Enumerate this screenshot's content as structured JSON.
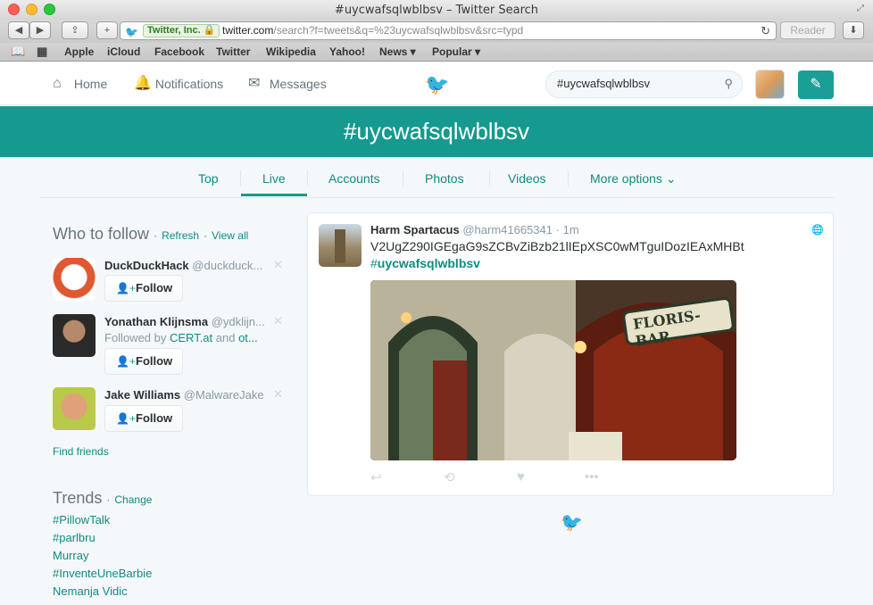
{
  "window": {
    "title": "#uycwafsqlwblbsv – Twitter Search"
  },
  "browser": {
    "ev_badge": "Twitter, Inc.",
    "url_host": "twitter.com",
    "url_path": "/search?f=tweets&q=%23uycwafsqlwblbsv&src=typd",
    "reader_label": "Reader",
    "bookmarks": [
      "Apple",
      "iCloud",
      "Facebook",
      "Twitter",
      "Wikipedia",
      "Yahoo!",
      "News ▾",
      "Popular ▾"
    ]
  },
  "nav": {
    "home": "Home",
    "notifications": "Notifications",
    "messages": "Messages",
    "search_value": "#uycwafsqlwblbsv"
  },
  "banner": {
    "title": "#uycwafsqlwblbsv"
  },
  "tabs": [
    "Top",
    "Live",
    "Accounts",
    "Photos",
    "Videos",
    "More options ⌄"
  ],
  "active_tab": "Live",
  "who_to_follow": {
    "title": "Who to follow",
    "refresh": "Refresh",
    "view_all": "View all",
    "suggestions": [
      {
        "name": "DuckDuckHack",
        "handle": "@duckduck...",
        "sub": "",
        "follow": "Follow"
      },
      {
        "name": "Yonathan Klijnsma",
        "handle": "@ydklijn...",
        "sub_prefix": "Followed by ",
        "sub_link1": "CERT.at",
        "sub_mid": " and ",
        "sub_link2": "ot...",
        "follow": "Follow"
      },
      {
        "name": "Jake Williams",
        "handle": "@MalwareJake",
        "sub": "",
        "follow": "Follow"
      }
    ],
    "find_friends": "Find friends"
  },
  "trends": {
    "title": "Trends",
    "change": "Change",
    "items": [
      "#PillowTalk",
      "#parlbru",
      "Murray",
      "#InventeUneBarbie",
      "Nemanja Vidic"
    ]
  },
  "tweet": {
    "author": "Harm Spartacus",
    "handle": "@harm41665341",
    "time": "1m",
    "text": "V2UgZ290IGEgaG9sZCBvZiBzb21lIEpXSC0wMTguIDozIEAxMHBt",
    "hashtag_prefix": "#",
    "hashtag": "uycwafsqlwblbsv",
    "image_sign": "FLORIS-BAR"
  },
  "colors": {
    "teal": "#16998f",
    "link": "#0f8a82"
  }
}
